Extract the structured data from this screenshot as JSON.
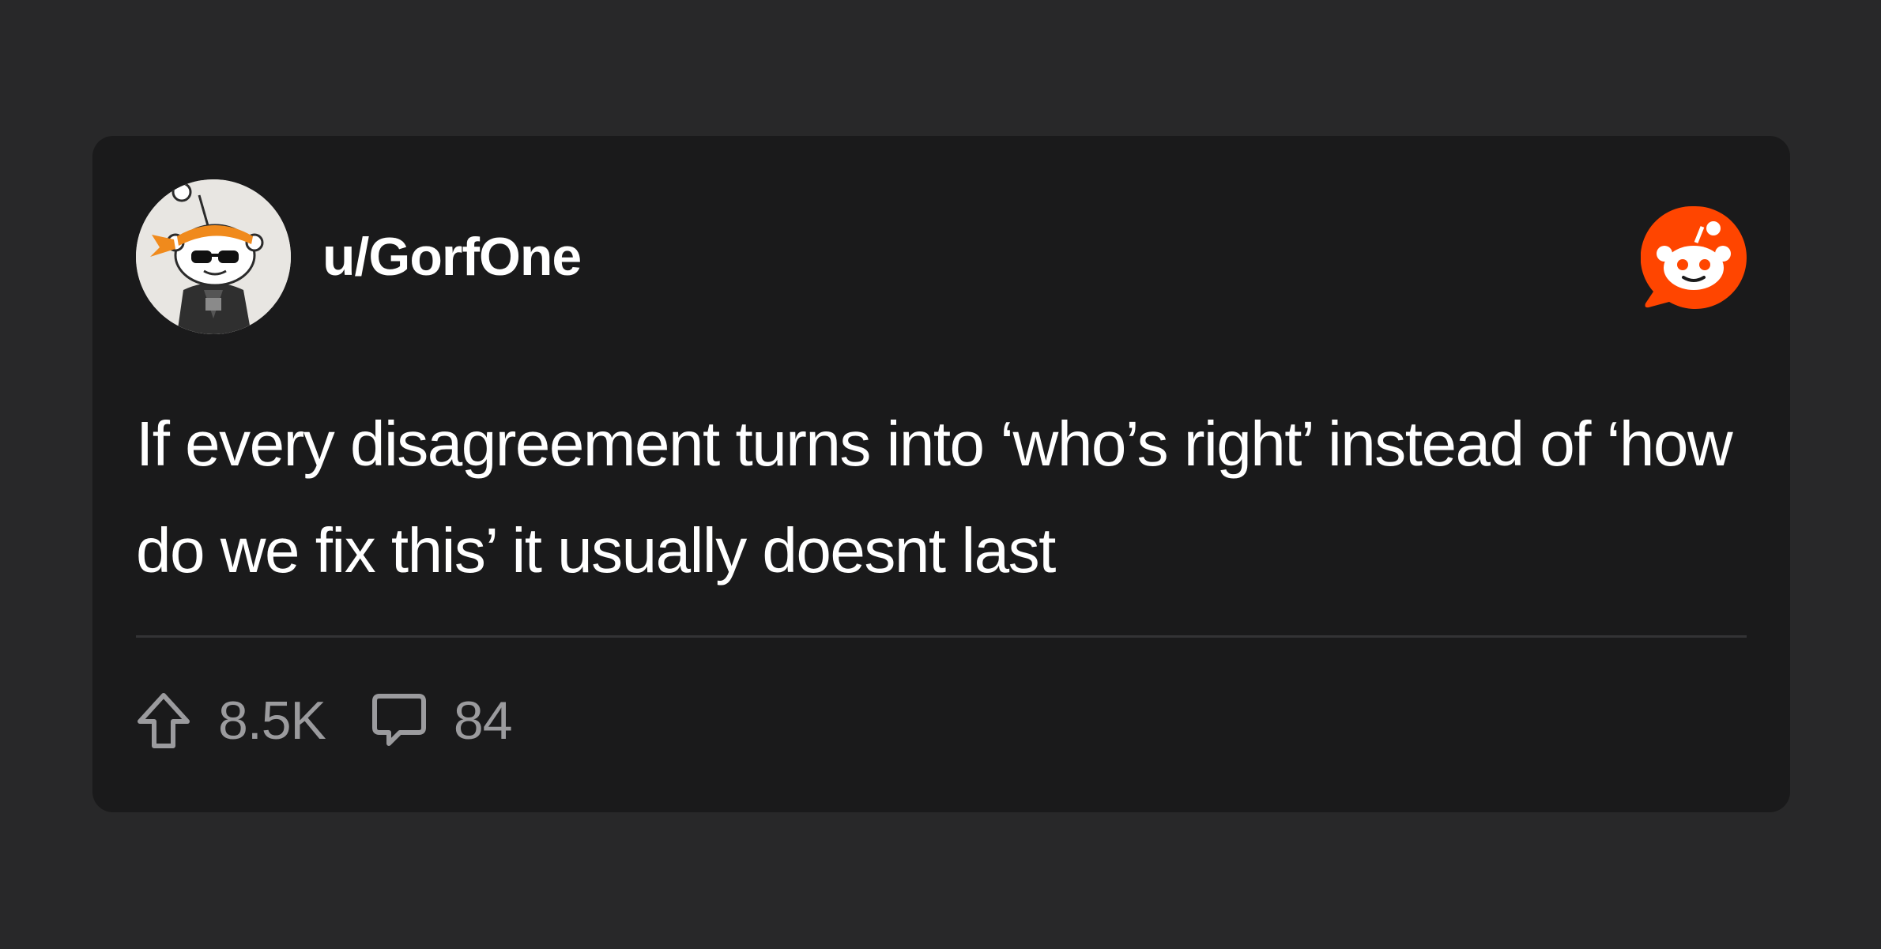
{
  "post": {
    "username": "u/GorfOne",
    "body": "If every disagreement turns into ‘who’s right’ instead of ‘how do we fix this’ it usually doesnt last",
    "upvotes": "8.5K",
    "comments": "84"
  },
  "icons": {
    "avatar": "snoo-avatar",
    "brand": "reddit-logo-icon",
    "upvote": "upvote-arrow-icon",
    "comment": "comment-bubble-icon"
  },
  "colors": {
    "page_background": "#282829",
    "card_background": "#1a1a1b",
    "brand_orange": "#ff4500",
    "text_primary": "#ffffff",
    "text_secondary": "#9b9b9e"
  }
}
